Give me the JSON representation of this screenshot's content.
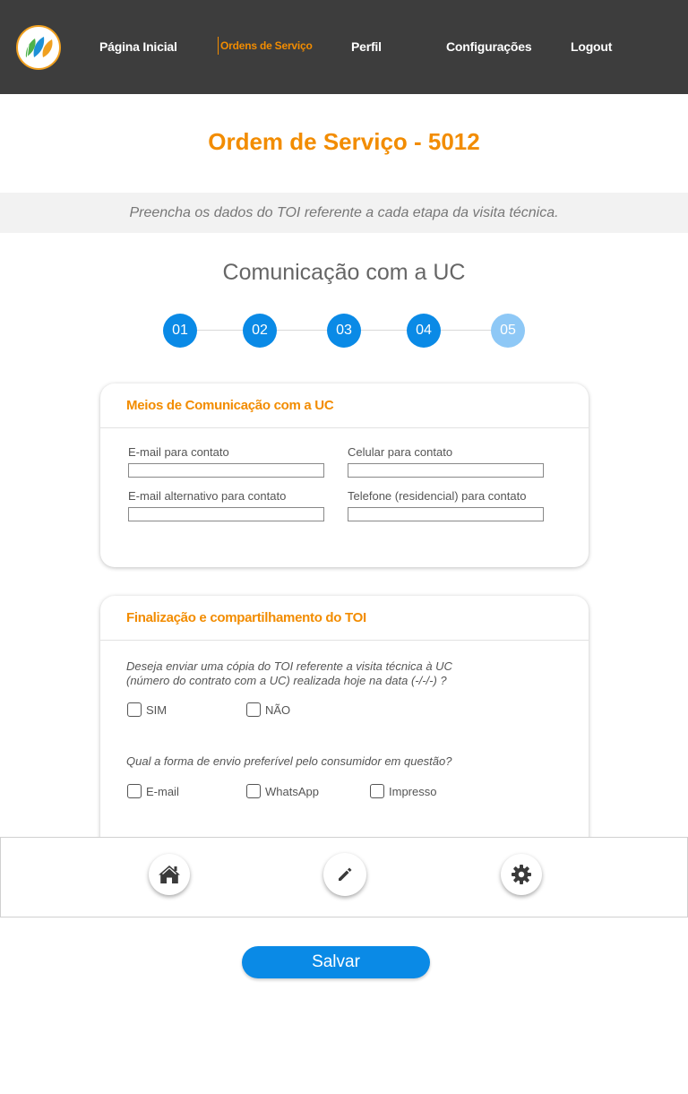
{
  "nav": {
    "home": "Página Inicial",
    "orders": "Ordens de Serviço",
    "profile": "Perfil",
    "settings": "Configurações",
    "logout": "Logout"
  },
  "page": {
    "title": "Ordem de Serviço - 5012",
    "subtitle": "Preencha os dados do TOI referente a cada etapa da visita técnica.",
    "section_title": "Comunicação com a UC"
  },
  "steps": [
    {
      "label": "01",
      "state": "done"
    },
    {
      "label": "02",
      "state": "done"
    },
    {
      "label": "03",
      "state": "done"
    },
    {
      "label": "04",
      "state": "done"
    },
    {
      "label": "05",
      "state": "current"
    }
  ],
  "communication_card": {
    "title": "Meios de Comunicação com a UC",
    "fields": {
      "email": {
        "label": "E-mail para contato",
        "value": ""
      },
      "mobile": {
        "label": "Celular para contato",
        "value": ""
      },
      "alt_email": {
        "label": "E-mail alternativo para contato",
        "value": ""
      },
      "phone": {
        "label": "Telefone (residencial) para contato",
        "value": ""
      }
    }
  },
  "finalization_card": {
    "title": "Finalização e compartilhamento do TOI",
    "question1_line1": "Deseja enviar uma cópia do TOI referente a visita técnica à UC",
    "question1_line2": "(número do contrato com a UC) realizada hoje na data (-/-/-) ?",
    "yes": "SIM",
    "no": "NÃO",
    "question2": "Qual a forma de envio preferível pelo consumidor em questão?",
    "opt_email": "E-mail",
    "opt_whatsapp": "WhatsApp",
    "opt_print": "Impresso"
  },
  "toolbar": {
    "home_icon": "home-icon",
    "edit_icon": "pencil-icon",
    "settings_icon": "gear-icon"
  },
  "save_label": "Salvar",
  "colors": {
    "accent": "#f28c00",
    "primary": "#0a8ae6",
    "primary_light": "#8ec8f6",
    "header_bg": "#3d3d3d"
  }
}
